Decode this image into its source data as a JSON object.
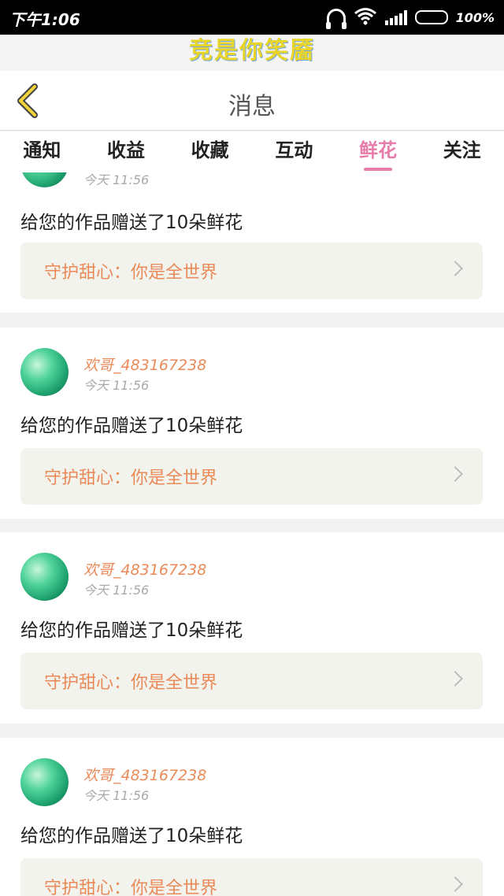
{
  "status_bar": {
    "time": "下午1:06",
    "battery": "100%"
  },
  "banner": {
    "text": "竞是你笑靥"
  },
  "navbar": {
    "title": "消息",
    "back_icon": "chevron-left-icon"
  },
  "tabs": [
    {
      "label": "通知",
      "active": false
    },
    {
      "label": "收益",
      "active": false
    },
    {
      "label": "收藏",
      "active": false
    },
    {
      "label": "互动",
      "active": false
    },
    {
      "label": "鲜花",
      "active": true
    },
    {
      "label": "关注",
      "active": false
    }
  ],
  "messages": [
    {
      "user": "",
      "time": "今天 11:56",
      "text": "给您的作品赠送了10朵鲜花",
      "work": "守护甜心：你是全世界"
    },
    {
      "user": "欢哥_483167238",
      "time": "今天 11:56",
      "text": "给您的作品赠送了10朵鲜花",
      "work": "守护甜心：你是全世界"
    },
    {
      "user": "欢哥_483167238",
      "time": "今天 11:56",
      "text": "给您的作品赠送了10朵鲜花",
      "work": "守护甜心：你是全世界"
    },
    {
      "user": "欢哥_483167238",
      "time": "今天 11:56",
      "text": "给您的作品赠送了10朵鲜花",
      "work": "守护甜心：你是全世界"
    }
  ],
  "colors": {
    "accent": "#e77caa",
    "username": "#e98a58",
    "battery": "#19a3e8"
  }
}
